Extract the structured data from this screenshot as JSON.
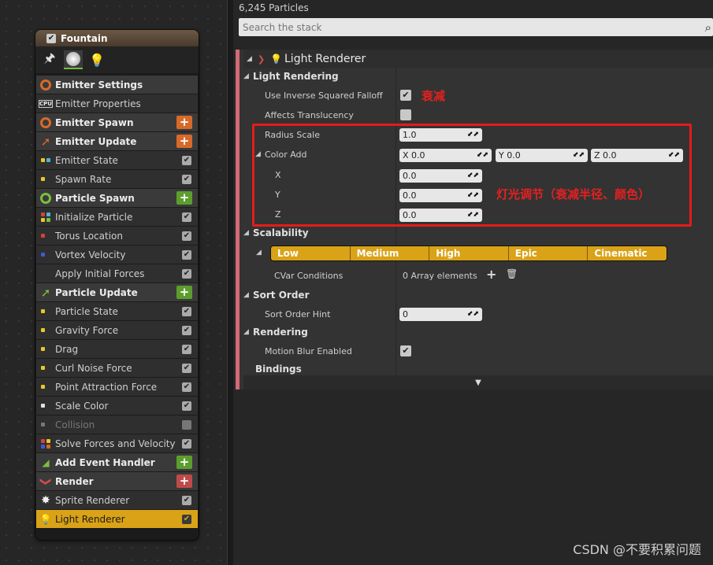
{
  "node": {
    "title": "Fountain",
    "rows": [
      {
        "label": "Emitter Settings",
        "type": "head",
        "icon": "emitter-settings-icon",
        "color": "#d76a2a"
      },
      {
        "label": "Emitter Properties",
        "type": "item",
        "icon": "cpu-icon",
        "icon_text": "CPU"
      },
      {
        "label": "Emitter Spawn",
        "type": "head",
        "icon": "emitter-spawn-icon",
        "color": "#d76a2a",
        "plus": "orange"
      },
      {
        "label": "Emitter Update",
        "type": "head",
        "icon": "emitter-update-icon",
        "color": "#d76a2a",
        "plus": "orange"
      },
      {
        "label": "Emitter State",
        "type": "item",
        "dots": [
          "#e6c828",
          "#4ab4d8"
        ],
        "check": true
      },
      {
        "label": "Spawn Rate",
        "type": "item",
        "dots": [
          "#e6c828"
        ],
        "check": true
      },
      {
        "label": "Particle Spawn",
        "type": "head",
        "icon": "particle-spawn-icon",
        "color": "#7ac03c",
        "plus": "green"
      },
      {
        "label": "Initialize Particle",
        "type": "item",
        "dots": [
          "#d84040",
          "#4ab4d8",
          "#e6c828",
          "#7ac03c"
        ],
        "check": true
      },
      {
        "label": "Torus Location",
        "type": "item",
        "dots": [
          "#d84040"
        ],
        "check": true
      },
      {
        "label": "Vortex Velocity",
        "type": "item",
        "dots": [
          "#3c5ad8"
        ],
        "check": true
      },
      {
        "label": "Apply Initial Forces",
        "type": "item",
        "dots": [],
        "check": true
      },
      {
        "label": "Particle Update",
        "type": "head",
        "icon": "particle-update-icon",
        "color": "#7ac03c",
        "plus": "green"
      },
      {
        "label": "Particle State",
        "type": "item",
        "dots": [
          "#e6c828"
        ],
        "check": true
      },
      {
        "label": "Gravity Force",
        "type": "item",
        "dots": [
          "#e6c828"
        ],
        "check": true
      },
      {
        "label": "Drag",
        "type": "item",
        "dots": [
          "#e6c828"
        ],
        "check": true
      },
      {
        "label": "Curl Noise Force",
        "type": "item",
        "dots": [
          "#e6c828"
        ],
        "check": true
      },
      {
        "label": "Point Attraction Force",
        "type": "item",
        "dots": [
          "#e6c828"
        ],
        "check": true
      },
      {
        "label": "Scale Color",
        "type": "item",
        "dots": [
          "#e0e0e0"
        ],
        "check": true
      },
      {
        "label": "Collision",
        "type": "item",
        "dots": [
          "#777777"
        ],
        "check": false,
        "dim": true
      },
      {
        "label": "Solve Forces and Velocity",
        "type": "item",
        "dots": [
          "#d84040",
          "#e6c828",
          "#3c5ad8",
          "#d86a20"
        ],
        "check": true
      },
      {
        "label": "Add Event Handler",
        "type": "head",
        "icon": "event-handler-icon",
        "color": "#7ac03c",
        "plus": "green"
      },
      {
        "label": "Render",
        "type": "head",
        "icon": "render-icon",
        "color": "#d84a4a",
        "plus": "red"
      },
      {
        "label": "Sprite Renderer",
        "type": "item",
        "icon": "sprite-icon",
        "check": true
      },
      {
        "label": "Light Renderer",
        "type": "item",
        "icon": "bulb-icon",
        "check": true,
        "selected": true
      }
    ]
  },
  "panel": {
    "particle_count": "6,245 Particles",
    "search_placeholder": "Search the stack",
    "header_title": "Light Renderer",
    "light_rendering": "Light Rendering",
    "use_inverse": "Use Inverse Squared Falloff",
    "affects_translucency": "Affects Translucency",
    "radius_scale": "Radius Scale",
    "radius_scale_value": "1.0",
    "color_add": "Color Add",
    "color_add_x": "X  0.0",
    "color_add_y": "Y  0.0",
    "color_add_z": "Z  0.0",
    "x_label": "X",
    "y_label": "Y",
    "z_label": "Z",
    "x_value": "0.0",
    "y_value": "0.0",
    "z_value": "0.0",
    "scalability": "Scalability",
    "scalability_levels": [
      "Low",
      "Medium",
      "High",
      "Epic",
      "Cinematic"
    ],
    "cvar_conditions": "CVar Conditions",
    "cvar_value": "0 Array elements",
    "sort_order": "Sort Order",
    "sort_order_hint": "Sort Order Hint",
    "sort_order_hint_value": "0",
    "rendering": "Rendering",
    "motion_blur": "Motion Blur Enabled",
    "bindings": "Bindings"
  },
  "annotations": {
    "falloff_note": "衰减",
    "light_note": "灯光调节（衰减半径、颜色）"
  },
  "watermark": "CSDN @不要积累问题",
  "colors": {
    "accent": "#d9a217",
    "annotation": "#e51b1b",
    "stripe": "#d36a74"
  }
}
